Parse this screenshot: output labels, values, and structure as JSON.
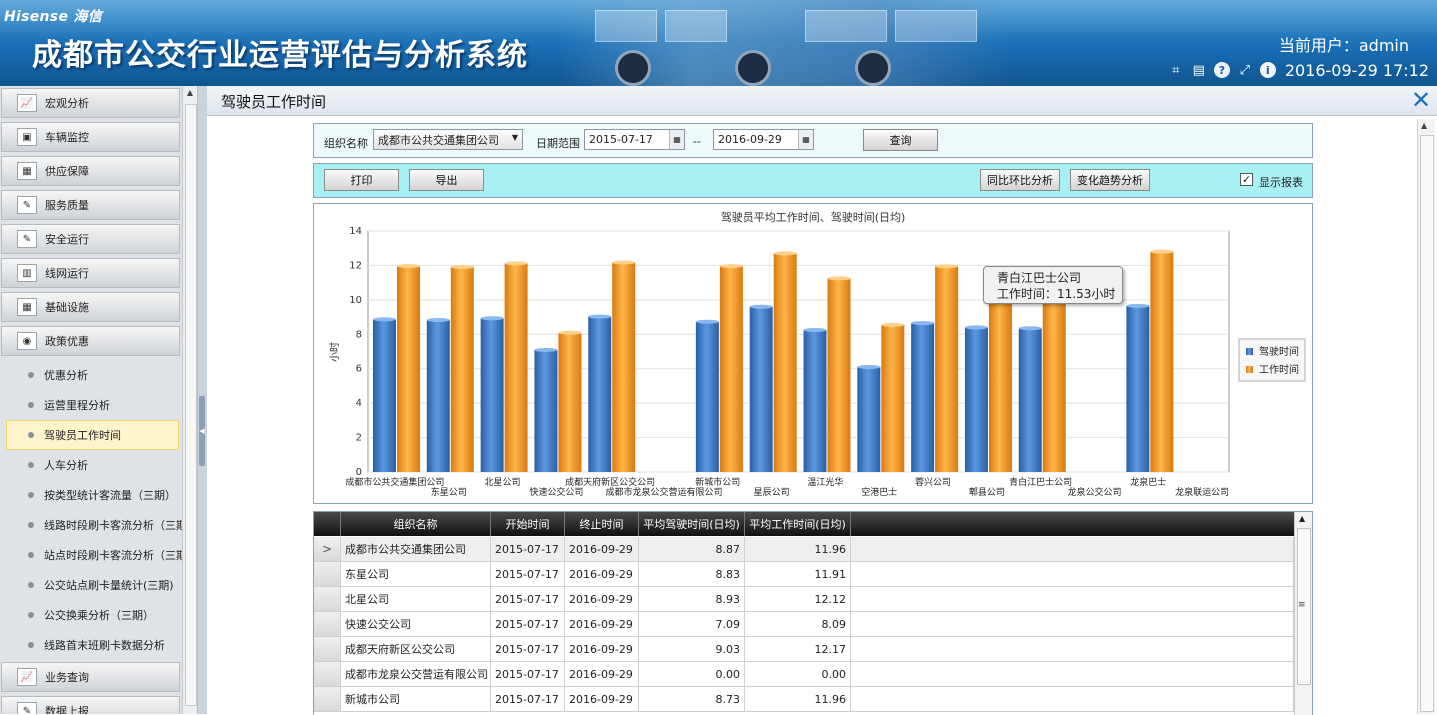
{
  "header": {
    "brand": "Hisense 海信",
    "system_title": "成都市公交行业运营评估与分析系统",
    "current_user": "当前用户：admin",
    "datetime": "2016-09-29 17:12",
    "tool_icons": [
      "crop-icon",
      "keyboard-icon",
      "help-icon",
      "link-icon",
      "info-icon"
    ]
  },
  "sidebar": {
    "menu_top": [
      {
        "label": "宏观分析",
        "icon": "chart-line-icon"
      },
      {
        "label": "车辆监控",
        "icon": "monitor-icon"
      },
      {
        "label": "供应保障",
        "icon": "supply-icon"
      },
      {
        "label": "服务质量",
        "icon": "quality-icon"
      },
      {
        "label": "安全运行",
        "icon": "safety-icon"
      },
      {
        "label": "线网运行",
        "icon": "network-icon"
      },
      {
        "label": "基础设施",
        "icon": "infrastructure-icon"
      },
      {
        "label": "政策优惠",
        "icon": "policy-icon"
      }
    ],
    "sub_items": [
      {
        "label": "优惠分析"
      },
      {
        "label": "运营里程分析"
      },
      {
        "label": "驾驶员工作时间",
        "active": true
      },
      {
        "label": "人车分析"
      },
      {
        "label": "按类型统计客流量（三期）"
      },
      {
        "label": "线路时段刷卡客流分析（三期"
      },
      {
        "label": "站点时段刷卡客流分析（三期"
      },
      {
        "label": "公交站点刷卡量统计(三期)"
      },
      {
        "label": "公交换乘分析（三期）"
      },
      {
        "label": "线路首末班刷卡数据分析"
      }
    ],
    "menu_bottom": [
      {
        "label": "业务查询",
        "icon": "query-icon"
      },
      {
        "label": "数据上报",
        "icon": "report-icon"
      }
    ]
  },
  "page": {
    "title": "驾驶员工作时间"
  },
  "filter": {
    "org_label": "组织名称",
    "org_value": "成都市公共交通集团公司",
    "date_label": "日期范围",
    "date_from": "2015-07-17",
    "date_sep": "--",
    "date_to": "2016-09-29",
    "query_button": "查询"
  },
  "actions": {
    "print": "打印",
    "export": "导出",
    "yoy": "同比环比分析",
    "trend": "变化趋势分析",
    "show_report_label": "显示报表",
    "show_report_checked": true
  },
  "tooltip": {
    "name": "青白江巴士公司",
    "text": "工作时间：11.53小时"
  },
  "table": {
    "columns": [
      "组织名称",
      "开始时间",
      "终止时间",
      "平均驾驶时间(日均)",
      "平均工作时间(日均)"
    ],
    "rows": [
      {
        "org": "成都市公共交通集团公司",
        "start": "2015-07-17",
        "end": "2016-09-29",
        "drive": "8.87",
        "work": "11.96",
        "selected": true
      },
      {
        "org": "东星公司",
        "start": "2015-07-17",
        "end": "2016-09-29",
        "drive": "8.83",
        "work": "11.91"
      },
      {
        "org": "北星公司",
        "start": "2015-07-17",
        "end": "2016-09-29",
        "drive": "8.93",
        "work": "12.12"
      },
      {
        "org": "快速公交公司",
        "start": "2015-07-17",
        "end": "2016-09-29",
        "drive": "7.09",
        "work": "8.09"
      },
      {
        "org": "成都天府新区公交公司",
        "start": "2015-07-17",
        "end": "2016-09-29",
        "drive": "9.03",
        "work": "12.17"
      },
      {
        "org": "成都市龙泉公交营运有限公司",
        "start": "2015-07-17",
        "end": "2016-09-29",
        "drive": "0.00",
        "work": "0.00"
      },
      {
        "org": "新城市公司",
        "start": "2015-07-17",
        "end": "2016-09-29",
        "drive": "8.73",
        "work": "11.96"
      }
    ],
    "selected_marker": ">"
  },
  "chart_data": {
    "type": "bar",
    "title": "驾驶员平均工作时间、驾驶时间(日均)",
    "ylabel": "小时",
    "ylim": [
      0,
      14
    ],
    "yticks": [
      0,
      2,
      4,
      6,
      8,
      10,
      12,
      14
    ],
    "grid": true,
    "legend_position": "right",
    "categories": [
      "成都市公共交通集团公司",
      "东星公司",
      "北星公司",
      "快速公交公司",
      "成都天府新区公交公司",
      "成都市龙泉公交营运有限公司",
      "新城市公司",
      "星辰公司",
      "温江光华",
      "空港巴士",
      "蓉兴公司",
      "郫县公司",
      "青白江巴士公司",
      "龙泉公交公司",
      "龙泉巴士",
      "龙泉联运公司"
    ],
    "series": [
      {
        "name": "驾驶时间",
        "color": "#3a78c9",
        "values": [
          8.87,
          8.83,
          8.93,
          7.09,
          9.03,
          0,
          8.73,
          9.6,
          8.25,
          6.1,
          8.65,
          8.4,
          8.35,
          0,
          9.65,
          0
        ]
      },
      {
        "name": "工作时间",
        "color": "#f49a26",
        "values": [
          11.96,
          11.91,
          12.12,
          8.09,
          12.17,
          0,
          11.96,
          12.7,
          11.25,
          8.55,
          11.95,
          9.9,
          11.53,
          0,
          12.8,
          0
        ]
      }
    ]
  }
}
